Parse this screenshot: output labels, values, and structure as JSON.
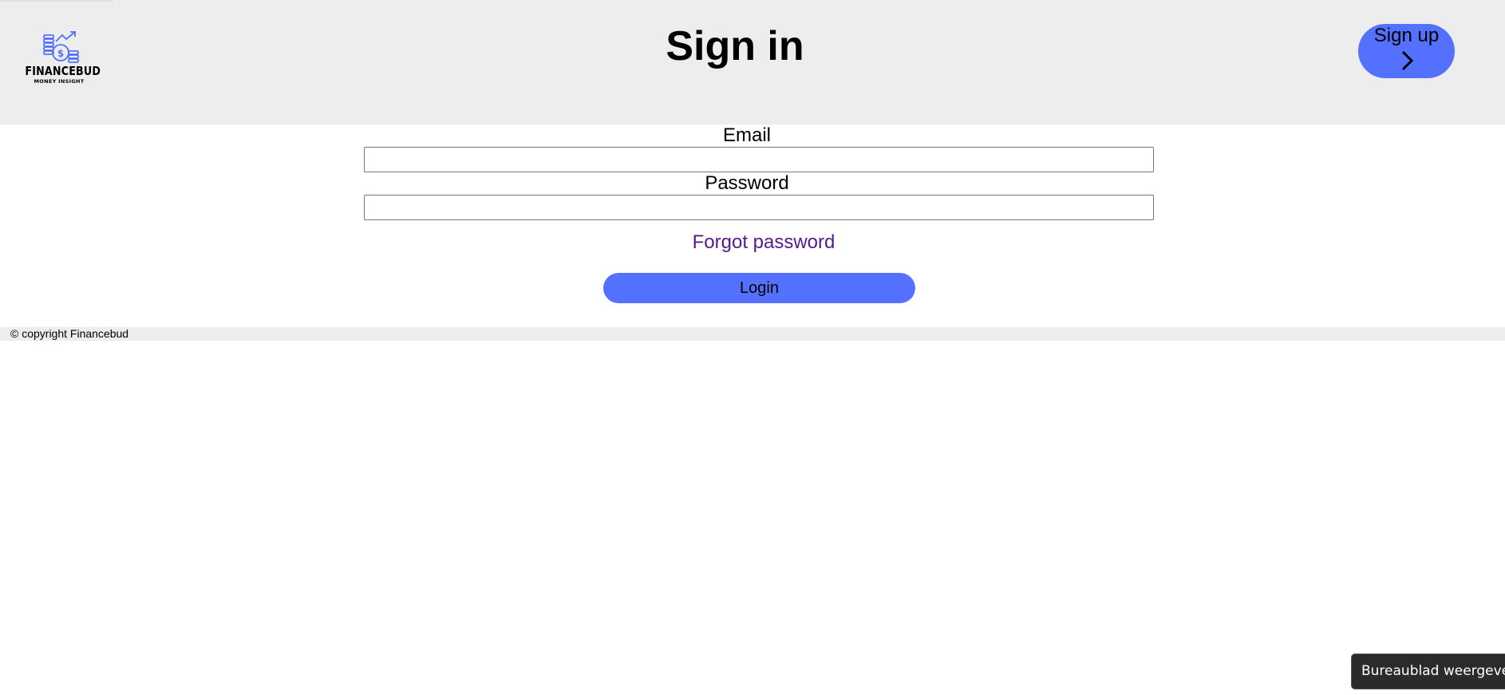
{
  "header": {
    "brand": "FINANCEBUD",
    "tagline": "MONEY INSIGHT",
    "title": "Sign in",
    "signup_label": "Sign up"
  },
  "icons": {
    "logo": "finance-logo-icon",
    "signup_arrow": "chevron-right-icon"
  },
  "form": {
    "email_label": "Email",
    "email_value": "",
    "password_label": "Password",
    "password_value": "",
    "forgot_label": "Forgot password",
    "login_label": "Login"
  },
  "footer": {
    "copyright": "© copyright Financebud"
  },
  "os": {
    "tooltip": "Bureaublad weergeven"
  },
  "colors": {
    "header_bg": "#ededed",
    "accent": "#5470fe",
    "link_visited": "#551a8b",
    "brand_icon": "#5470fe"
  }
}
